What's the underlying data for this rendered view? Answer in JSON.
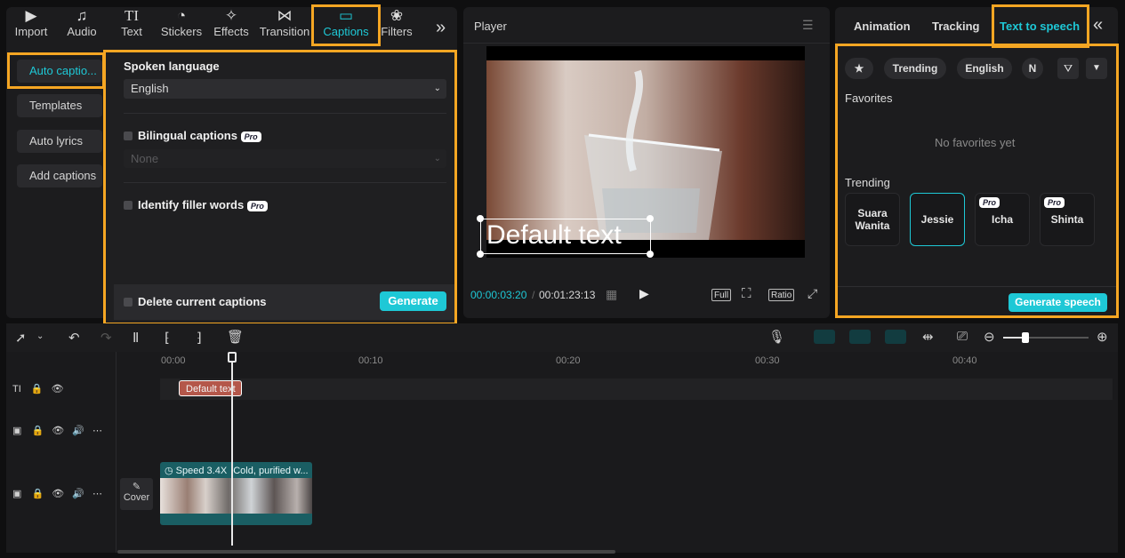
{
  "toolbar": {
    "tabs": [
      {
        "label": "Import",
        "icon": "import-icon",
        "glyph": "▶"
      },
      {
        "label": "Audio",
        "icon": "audio-icon",
        "glyph": "♫"
      },
      {
        "label": "Text",
        "icon": "text-icon",
        "glyph": "TI"
      },
      {
        "label": "Stickers",
        "icon": "stickers-icon",
        "glyph": "◔"
      },
      {
        "label": "Effects",
        "icon": "effects-icon",
        "glyph": "✧"
      },
      {
        "label": "Transition",
        "icon": "transition-icon",
        "glyph": "⋈"
      },
      {
        "label": "Captions",
        "icon": "captions-icon",
        "glyph": "▭"
      },
      {
        "label": "Filters",
        "icon": "filters-icon",
        "glyph": "❀"
      }
    ],
    "more_glyph": "»"
  },
  "captions_menu": [
    "Auto captio...",
    "Templates",
    "Auto lyrics",
    "Add captions"
  ],
  "captions_panel": {
    "spoken_language_label": "Spoken language",
    "spoken_language_value": "English",
    "bilingual_label": "Bilingual captions",
    "bilingual_value": "None",
    "filler_label": "Identify filler words",
    "pro_badge": "Pro",
    "delete_label": "Delete current captions",
    "generate_label": "Generate"
  },
  "player": {
    "title": "Player",
    "overlay_text": "Default text",
    "current_time": "00:00:03:20",
    "total_time": "00:01:23:13",
    "full_label": "Full",
    "ratio_label": "Ratio"
  },
  "right_panel": {
    "tabs": [
      "Animation",
      "Tracking",
      "Text to speech"
    ],
    "chips": [
      "Trending",
      "English",
      "N"
    ],
    "favorites_label": "Favorites",
    "no_favorites": "No favorites yet",
    "trending_label": "Trending",
    "voices": [
      {
        "name": "Suara Wanita",
        "pro": false
      },
      {
        "name": "Jessie",
        "pro": false,
        "selected": true
      },
      {
        "name": "Icha",
        "pro": true
      },
      {
        "name": "Shinta",
        "pro": true
      }
    ],
    "generate_speech_label": "Generate speech"
  },
  "timeline": {
    "ticks": [
      "00:00",
      "00:10",
      "00:20",
      "00:30",
      "00:40"
    ],
    "text_clip": "Default text",
    "video_clip_speed": "Speed 3.4X",
    "video_clip_title": "Cold, purified w...",
    "cover_label": "Cover"
  },
  "colors": {
    "accent": "#1ec8d6",
    "highlight": "#f5a623"
  }
}
